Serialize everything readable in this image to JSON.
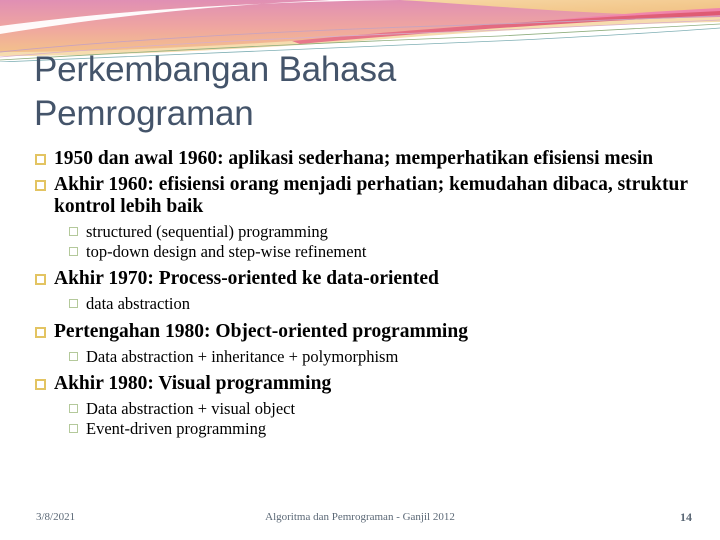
{
  "slide": {
    "title": "Perkembangan Bahasa Pemrograman",
    "bullets": [
      {
        "level": 1,
        "text": "1950 dan awal 1960: aplikasi sederhana; memperhatikan efisiensi mesin"
      },
      {
        "level": 1,
        "text": "Akhir 1960: efisiensi orang menjadi perhatian; kemudahan dibaca, struktur kontrol lebih baik"
      },
      {
        "level": 2,
        "text": "structured (sequential) programming"
      },
      {
        "level": 2,
        "text": "top-down design and step-wise refinement"
      },
      {
        "level": 1,
        "text": "Akhir 1970: Process-oriented ke data-oriented"
      },
      {
        "level": 2,
        "text": "data abstraction"
      },
      {
        "level": 1,
        "text": "Pertengahan 1980: Object-oriented programming"
      },
      {
        "level": 2,
        "text": "Data abstraction + inheritance + polymorphism"
      },
      {
        "level": 1,
        "text": "Akhir 1980: Visual programming"
      },
      {
        "level": 2,
        "text": "Data abstraction + visual object"
      },
      {
        "level": 2,
        "text": "Event-driven programming"
      }
    ]
  },
  "footer": {
    "date": "3/8/2021",
    "center": "Algoritma dan Pemrograman - Ganjil 2012",
    "page": "14"
  },
  "theme": {
    "title_color": "#44546A",
    "bullet_level1_color": "#E3C462",
    "bullet_level2_color": "#B4C99B",
    "footer_color": "#5B6876",
    "banner_pink": "#E496B6",
    "banner_peach": "#F5CB83",
    "banner_crimson": "#E0687C",
    "banner_cream": "#F6DCAF"
  }
}
